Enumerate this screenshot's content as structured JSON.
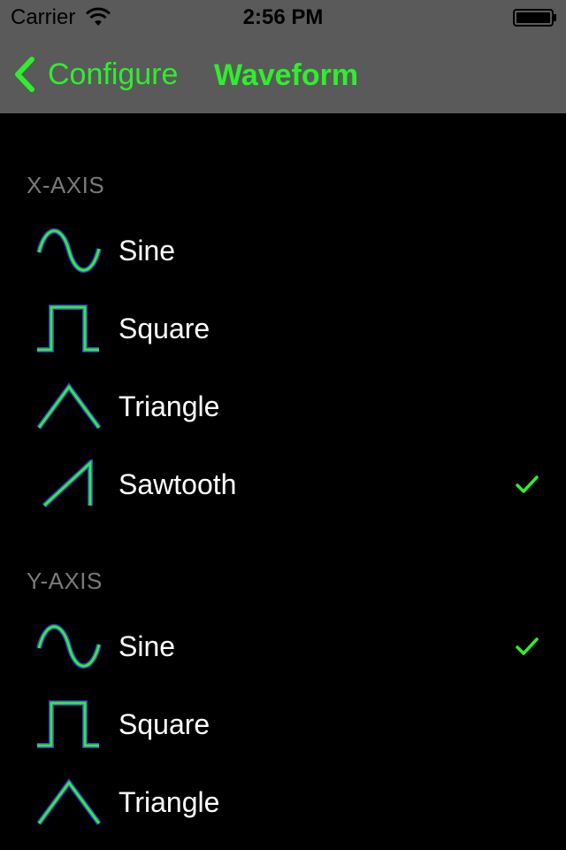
{
  "status_bar": {
    "carrier": "Carrier",
    "time": "2:56 PM"
  },
  "nav": {
    "back_label": "Configure",
    "title": "Waveform"
  },
  "colors": {
    "accent": "#2cf02c",
    "nav_background": "#5a5a5a",
    "background": "#000000",
    "section_header": "#7a7a7a",
    "icon_outline": "#3a3ad8"
  },
  "sections": [
    {
      "header": "X-AXIS",
      "items": [
        {
          "label": "Sine",
          "icon": "sine-wave-icon",
          "selected": false
        },
        {
          "label": "Square",
          "icon": "square-wave-icon",
          "selected": false
        },
        {
          "label": "Triangle",
          "icon": "triangle-wave-icon",
          "selected": false
        },
        {
          "label": "Sawtooth",
          "icon": "sawtooth-wave-icon",
          "selected": true
        }
      ]
    },
    {
      "header": "Y-AXIS",
      "items": [
        {
          "label": "Sine",
          "icon": "sine-wave-icon",
          "selected": true
        },
        {
          "label": "Square",
          "icon": "square-wave-icon",
          "selected": false
        },
        {
          "label": "Triangle",
          "icon": "triangle-wave-icon",
          "selected": false
        }
      ]
    }
  ]
}
